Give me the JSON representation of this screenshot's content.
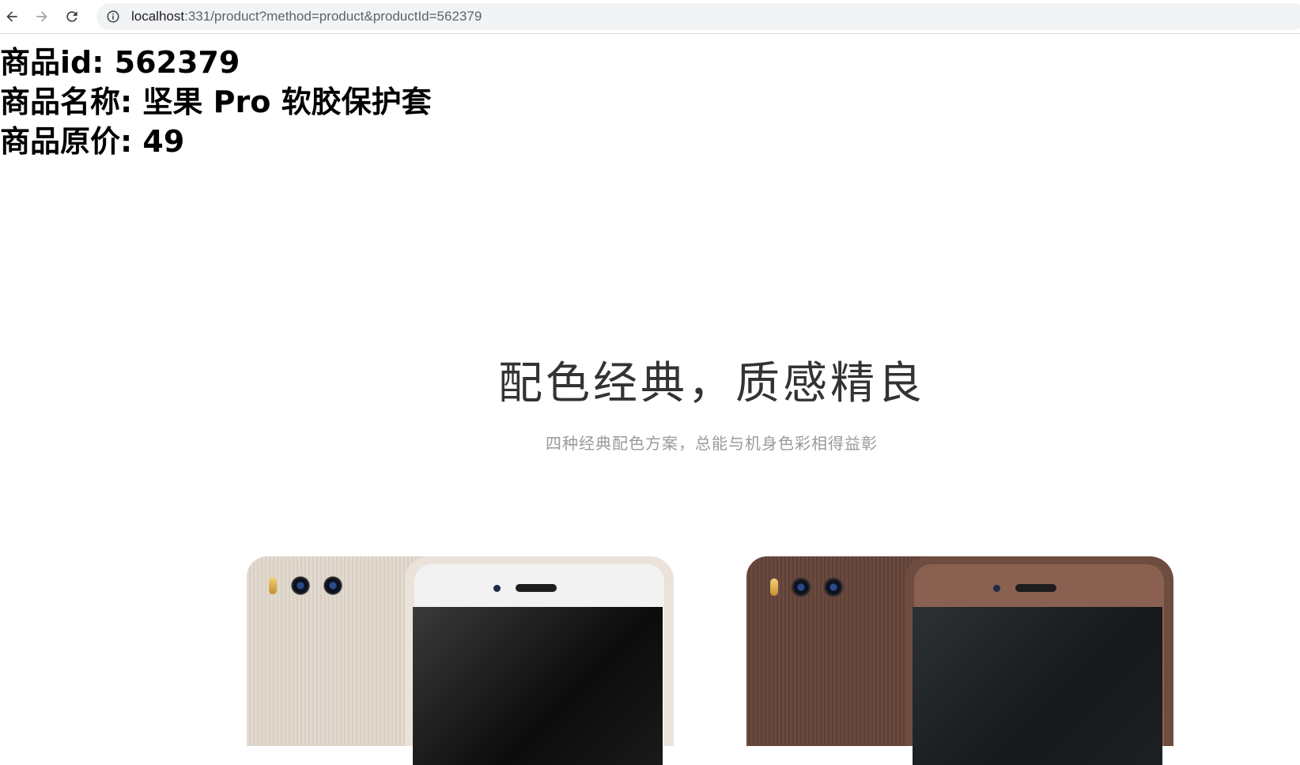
{
  "browser": {
    "back_icon": "arrow-left-icon",
    "forward_icon": "arrow-right-icon",
    "reload_icon": "reload-icon",
    "site_info_icon": "info-circle-icon",
    "url_host": "localhost",
    "url_path": ":331/product?method=product&productId=562379"
  },
  "product": {
    "id_line": "商品id: 562379",
    "name_line": "商品名称: 坚果 Pro 软胶保护套",
    "price_line": "商品原价: 49"
  },
  "banner": {
    "headline": "配色经典，质感精良",
    "subline": "四种经典配色方案，总能与机身色彩相得益彰"
  },
  "colors": {
    "case_beige": "#e6ddd3",
    "case_beige_rim": "#efe8e0",
    "case_brown": "#6b4a3e",
    "case_brown_rim": "#7a5547"
  }
}
